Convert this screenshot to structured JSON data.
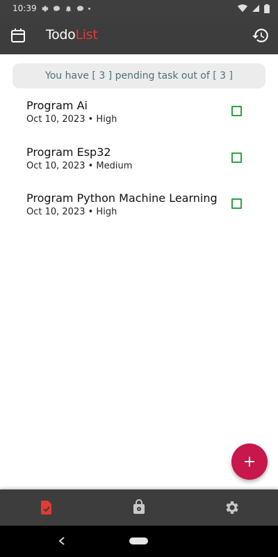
{
  "status_bar": {
    "time": "10:39"
  },
  "app_bar": {
    "title_main": "Todo",
    "title_accent": "List",
    "accent_color": "#e53935"
  },
  "summary": {
    "text": "You have [ 3 ] pending task out of [ 3 ]"
  },
  "tasks": [
    {
      "title": "Program Ai",
      "meta": "Oct 10, 2023 • High",
      "done": false
    },
    {
      "title": "Program Esp32",
      "meta": "Oct 10, 2023 • Medium",
      "done": false
    },
    {
      "title": "Program Python Machine Learning",
      "meta": "Oct 10, 2023 • High",
      "done": false
    }
  ],
  "fab": {
    "icon": "plus-icon",
    "color": "#c8174a"
  },
  "bottom_nav": {
    "items": [
      {
        "icon": "task-document-icon",
        "active": true,
        "active_color": "#e53935"
      },
      {
        "icon": "vault-icon",
        "active": false
      },
      {
        "icon": "gear-icon",
        "active": false
      }
    ]
  },
  "colors": {
    "bar_background": "#3d3d3d",
    "check_green": "#2ea043",
    "summary_text": "#4f6f78"
  }
}
